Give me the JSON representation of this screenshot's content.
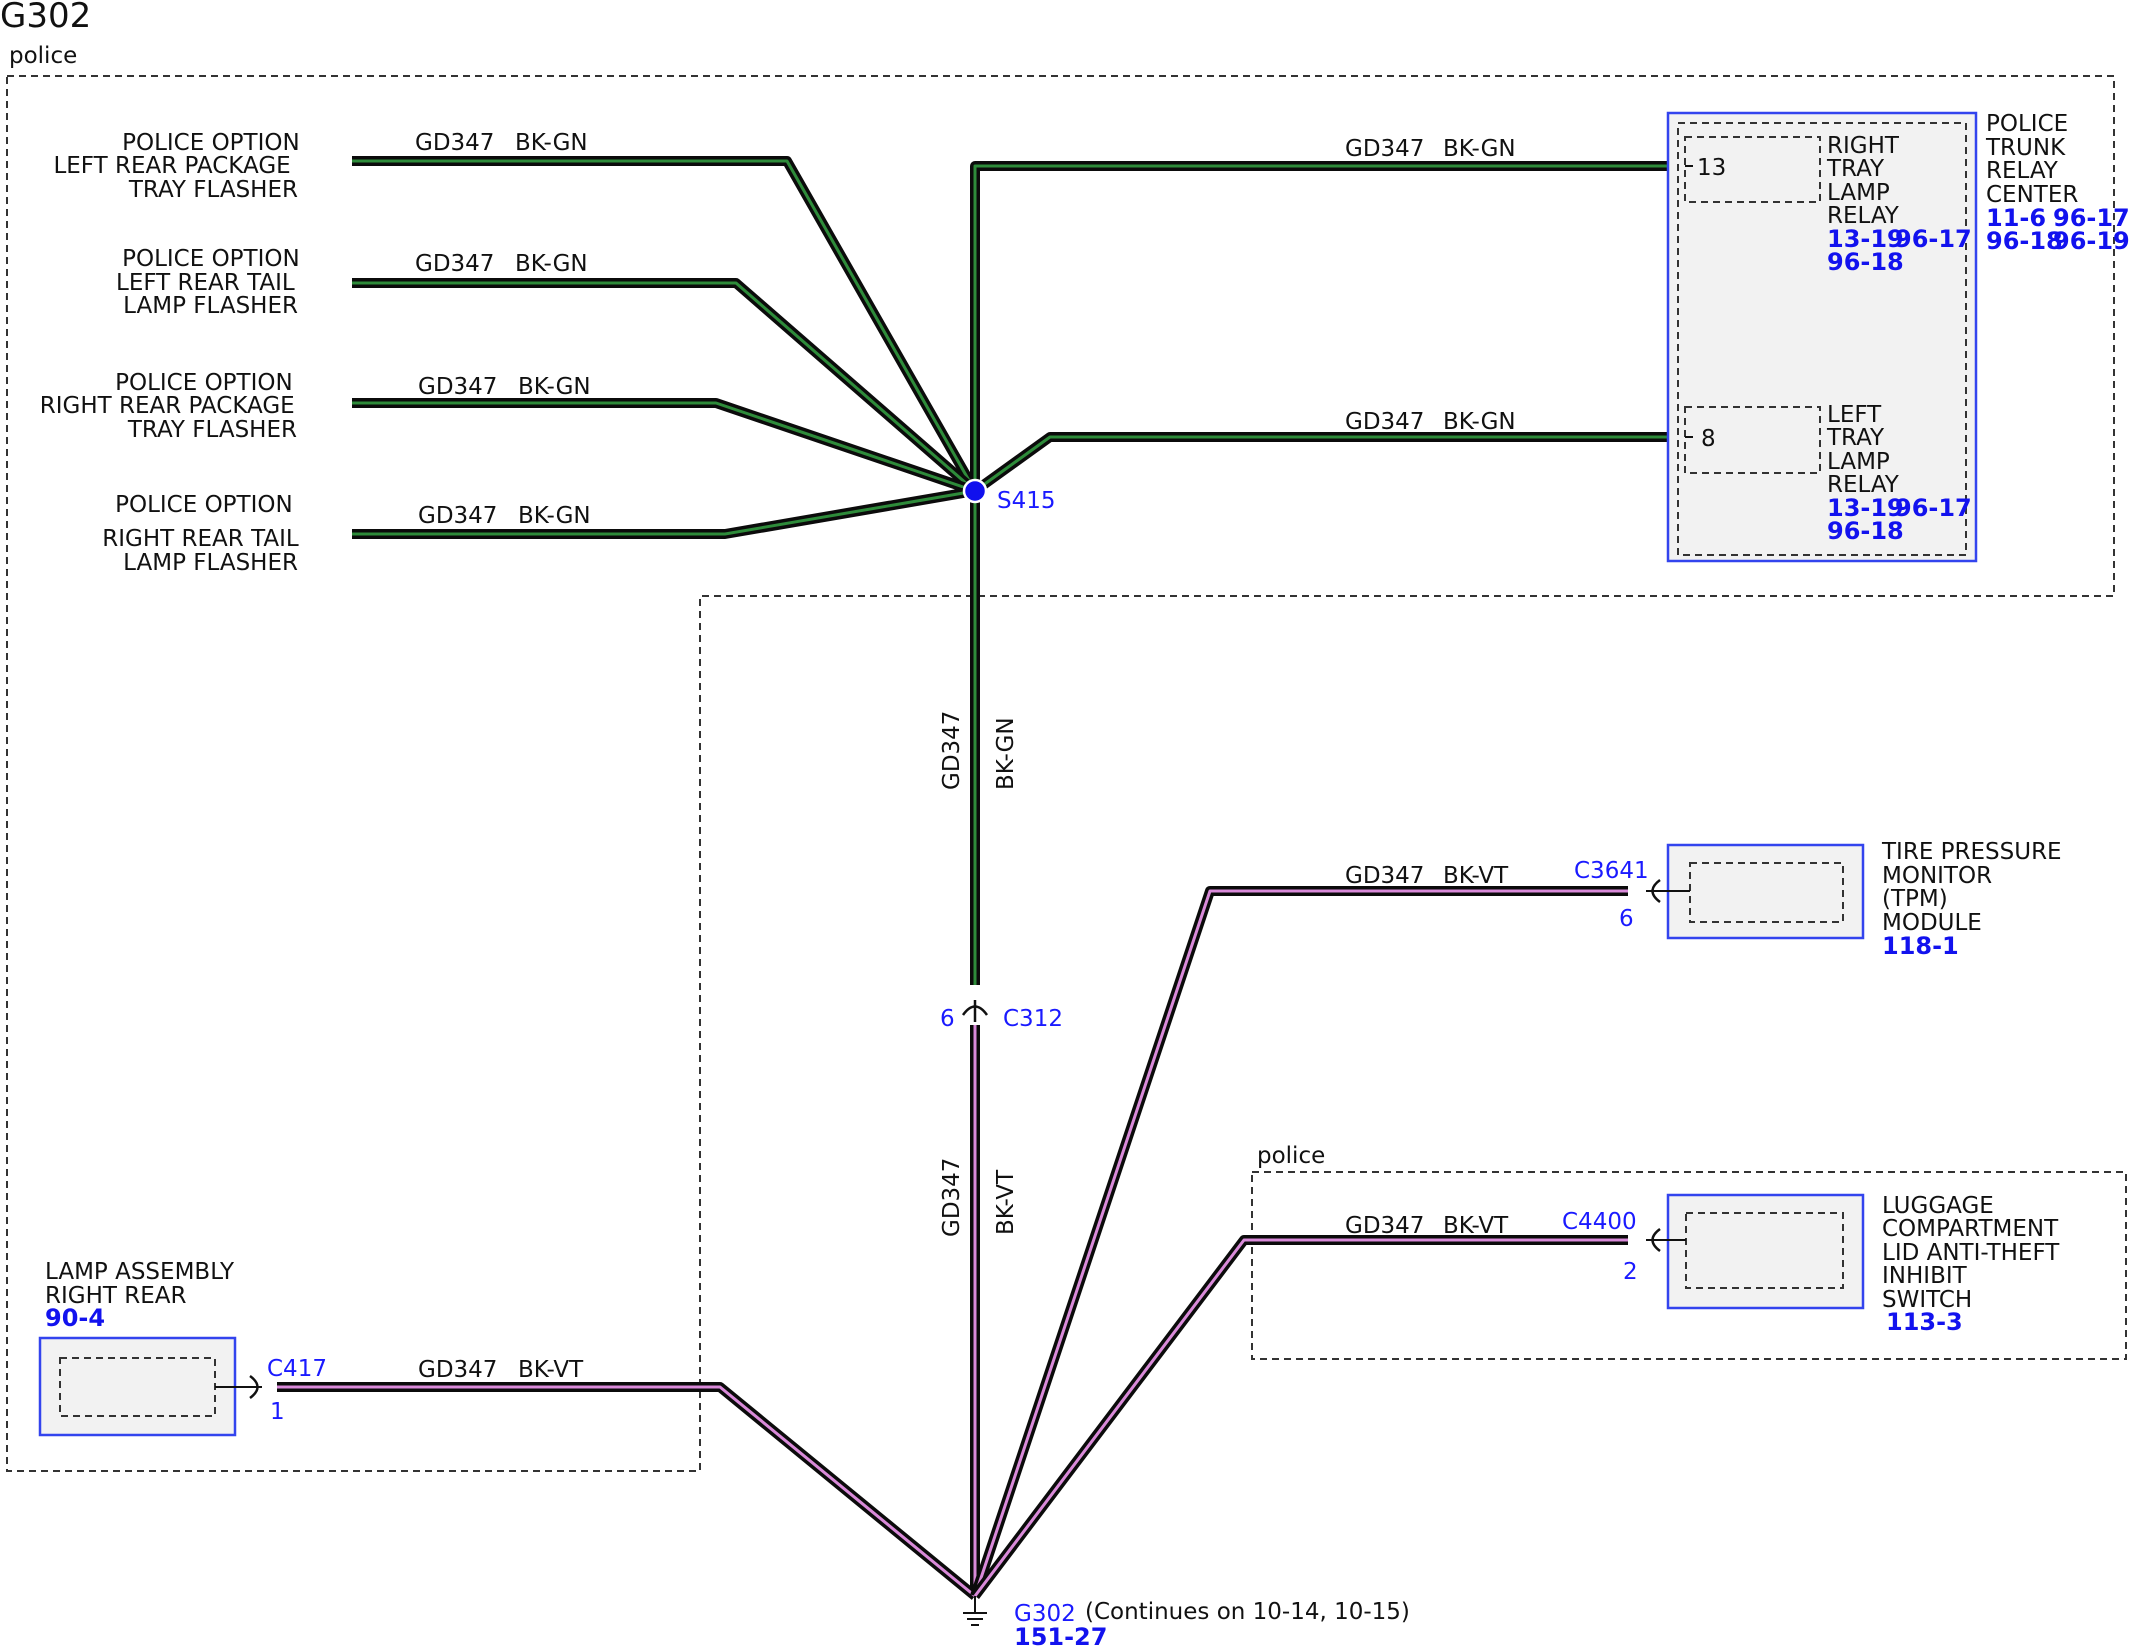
{
  "title": "G302",
  "regions": {
    "police_label": "police",
    "police_label_2": "police"
  },
  "wire": {
    "circuit": "GD347",
    "color_gn": "BK-GN",
    "color_vt": "BK-VT"
  },
  "colors": {
    "wire_gn": "#2e8b3a",
    "wire_vt": "#d98ad9",
    "wire_core": "#0b0b0b",
    "component_blue": "#3344ee",
    "ref_blue": "#1212ee",
    "splice": "#1010ee"
  },
  "left_sources": [
    {
      "lines": [
        "POLICE OPTION",
        "LEFT REAR PACKAGE",
        "TRAY FLASHER"
      ]
    },
    {
      "lines": [
        "POLICE OPTION",
        "LEFT REAR TAIL",
        "LAMP FLASHER"
      ]
    },
    {
      "lines": [
        "POLICE OPTION",
        "RIGHT REAR PACKAGE",
        "TRAY FLASHER"
      ]
    },
    {
      "lines": [
        "POLICE OPTION",
        "RIGHT REAR TAIL",
        "LAMP FLASHER"
      ]
    }
  ],
  "splice": {
    "id": "S415"
  },
  "relay_center": {
    "name_lines": [
      "POLICE",
      "TRUNK",
      "RELAY",
      "CENTER"
    ],
    "refs_line1": [
      "11-6",
      "96-17"
    ],
    "refs_line2": [
      "96-18",
      "96-19"
    ],
    "relays": [
      {
        "pin": "13",
        "name_lines": [
          "RIGHT",
          "TRAY",
          "LAMP",
          "RELAY"
        ],
        "refs_line1": [
          "13-19",
          "96-17"
        ],
        "refs_line2": [
          "96-18"
        ]
      },
      {
        "pin": "8",
        "name_lines": [
          "LEFT",
          "TRAY",
          "LAMP",
          "RELAY"
        ],
        "refs_line1": [
          "13-19",
          "96-17"
        ],
        "refs_line2": [
          "96-18"
        ]
      }
    ]
  },
  "c312": {
    "id": "C312",
    "pin": "6"
  },
  "tpm": {
    "connector": "C3641",
    "pin": "6",
    "name_lines": [
      "TIRE PRESSURE",
      "MONITOR",
      "(TPM)",
      "MODULE"
    ],
    "ref": "118-1"
  },
  "luggage": {
    "connector": "C4400",
    "pin": "2",
    "name_lines": [
      "LUGGAGE",
      "COMPARTMENT",
      "LID ANTI-THEFT",
      "INHIBIT",
      "SWITCH"
    ],
    "ref": "113-3"
  },
  "lamp": {
    "connector": "C417",
    "pin": "1",
    "name_lines": [
      "LAMP ASSEMBLY",
      "RIGHT REAR"
    ],
    "ref": "90-4"
  },
  "ground": {
    "id": "G302",
    "note": "(Continues on 10-14, 10-15)",
    "ref": "151-27"
  }
}
